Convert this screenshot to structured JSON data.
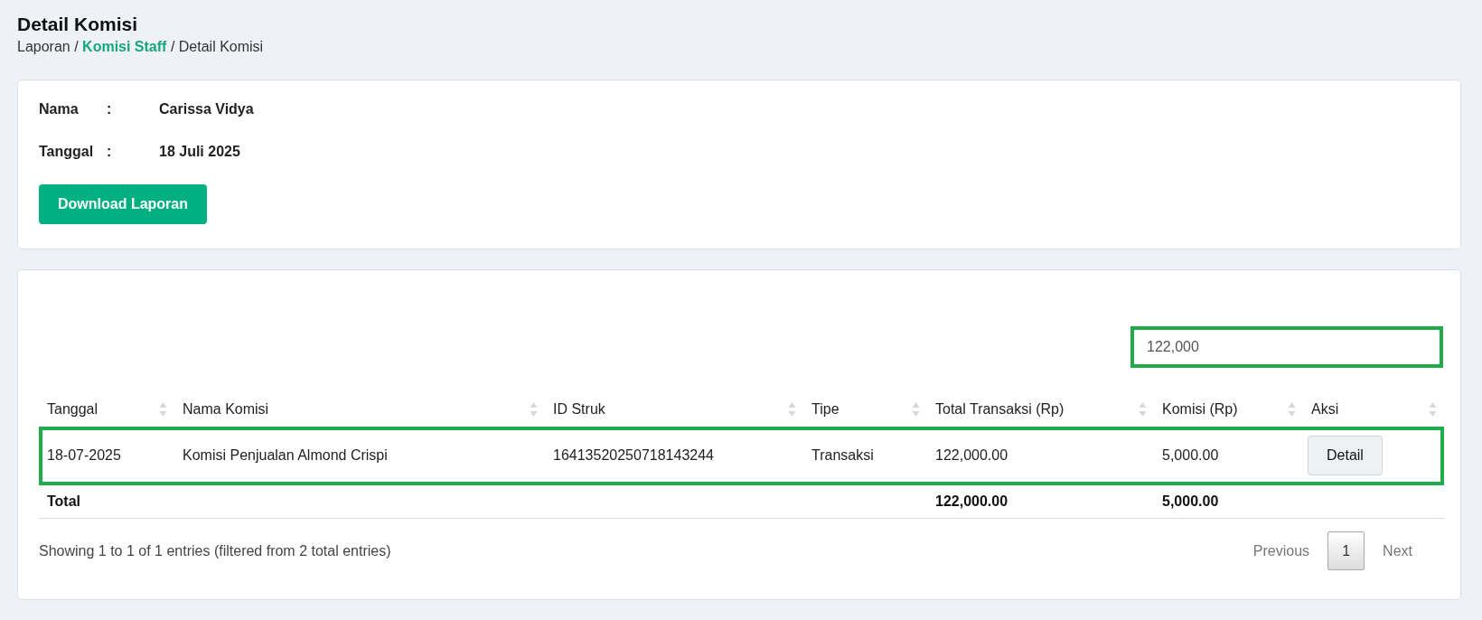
{
  "header": {
    "title": "Detail Komisi",
    "breadcrumb": [
      {
        "label": "Laporan",
        "link": false
      },
      {
        "label": "/",
        "link": false
      },
      {
        "label": "Komisi Staff",
        "link": true
      },
      {
        "label": "/",
        "link": false
      },
      {
        "label": "Detail Komisi",
        "link": false
      }
    ]
  },
  "info": {
    "fields": [
      {
        "label": "Nama",
        "separator": ":",
        "value": "Carissa Vidya"
      },
      {
        "label": "Tanggal",
        "separator": ":",
        "value": "18 Juli 2025"
      }
    ],
    "download_button": "Download Laporan"
  },
  "table": {
    "search": {
      "value": "122,000",
      "highlighted": true
    },
    "columns": [
      "Tanggal",
      "Nama Komisi",
      "ID Struk",
      "Tipe",
      "Total Transaksi (Rp)",
      "Komisi (Rp)",
      "Aksi"
    ],
    "rows": [
      {
        "highlighted": true,
        "cells": [
          "18-07-2025",
          "Komisi Penjualan Almond Crispi",
          "16413520250718143244",
          "Transaksi",
          "122,000.00",
          "5,000.00"
        ],
        "action": "Detail"
      }
    ],
    "footer": {
      "label": "Total",
      "total_transaksi": "122,000.00",
      "komisi": "5,000.00"
    },
    "info": "Showing 1 to 1 of 1 entries (filtered from 2 total entries)",
    "pagination": {
      "previous": "Previous",
      "pages": [
        {
          "label": "1",
          "selected": true
        }
      ],
      "next": "Next"
    }
  }
}
